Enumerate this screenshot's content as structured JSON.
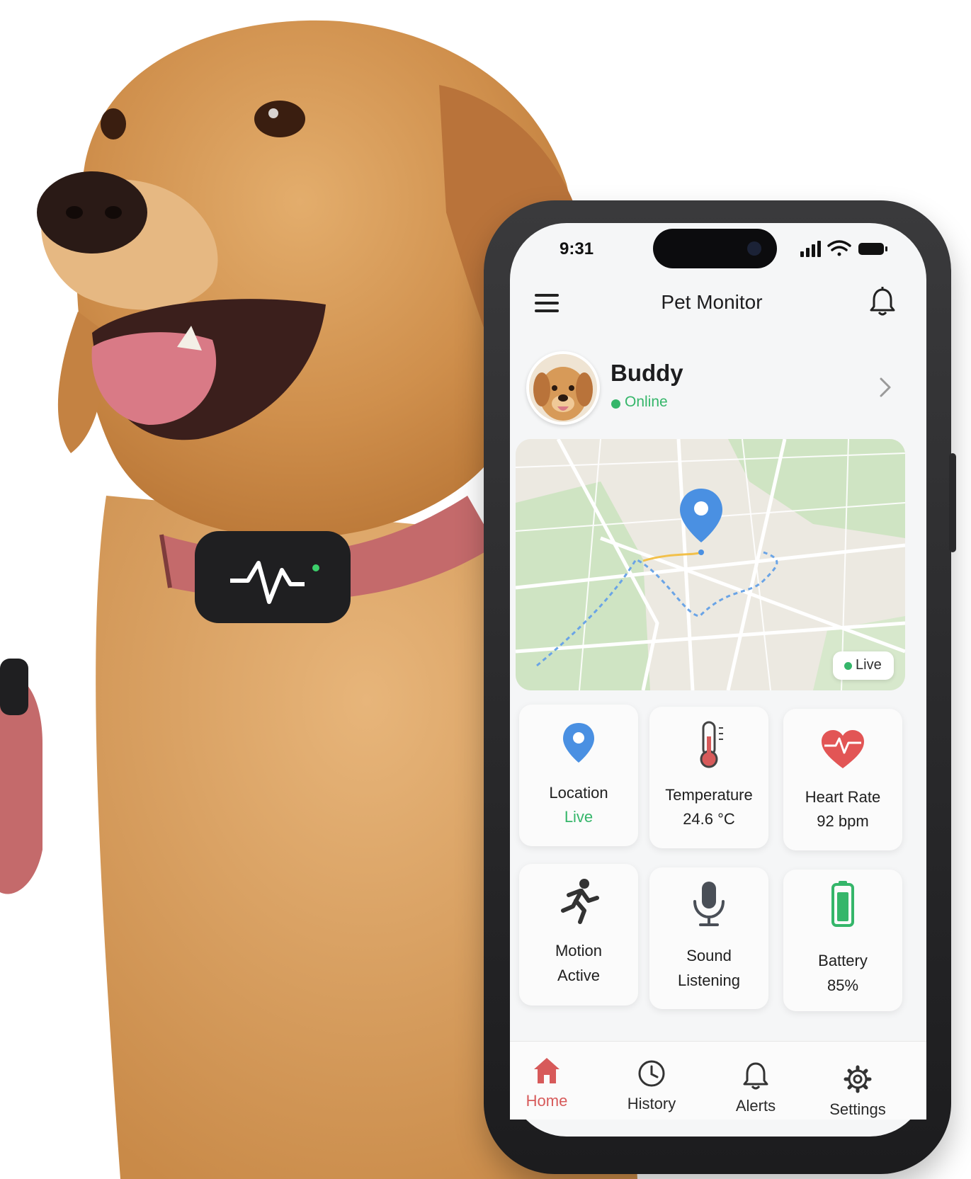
{
  "status_bar": {
    "time": "9:31"
  },
  "app_bar": {
    "title": "Pet Monitor"
  },
  "pet": {
    "name": "Buddy",
    "status": "Online"
  },
  "map": {
    "badge": "Live"
  },
  "tiles": [
    {
      "label": "Location",
      "value": "Live",
      "icon": "map-pin-icon",
      "value_color": "#35b66a"
    },
    {
      "label": "Temperature",
      "value": "24.6 °C",
      "icon": "thermometer-icon"
    },
    {
      "label": "Heart Rate",
      "value": "92 bpm",
      "icon": "heart-rate-icon"
    },
    {
      "label": "Motion",
      "value": "Active",
      "icon": "running-icon"
    },
    {
      "label": "Sound",
      "value": "Listening",
      "icon": "microphone-icon"
    },
    {
      "label": "Battery",
      "value": "85%",
      "icon": "battery-icon"
    }
  ],
  "bottom_nav": [
    {
      "label": "Home",
      "icon": "home-icon",
      "active": true
    },
    {
      "label": "History",
      "icon": "clock-icon"
    },
    {
      "label": "Alerts",
      "icon": "bell-icon"
    },
    {
      "label": "Settings",
      "icon": "gear-icon"
    }
  ],
  "colors": {
    "accent": "#d75a5a",
    "online": "#35b66a",
    "pin": "#4a90e2",
    "battery": "#35b66a",
    "heart": "#e25555"
  }
}
